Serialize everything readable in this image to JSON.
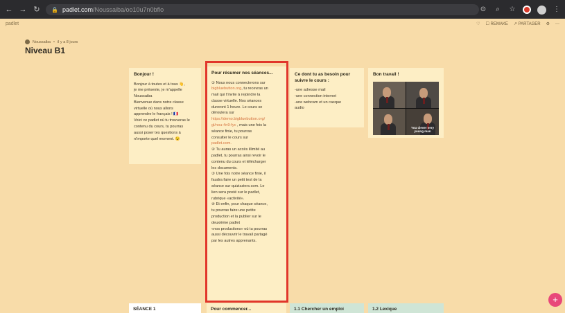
{
  "browser": {
    "url_host": "padlet.com",
    "url_path": "/Noussaiba/oo10u7n0bflo",
    "lock_icon": "lock-icon"
  },
  "padlet": {
    "brand": "padlet",
    "actions": [
      "♡",
      "☐ REMAKE",
      "↗ PARTAGER",
      "⚙",
      "⋯"
    ],
    "breadcrumb_author": "Noussaiba",
    "breadcrumb_sep": "•",
    "breadcrumb_time": "il y a 8 jours",
    "title": "Niveau B1"
  },
  "cards": [
    {
      "title": "Bonjour !",
      "body": "Bonjour à toutes et à tous 👋,\nje me présente, je m'appelle\nNoussaiba\nBienvenue dans notre classe\nvirtuelle où nous allons\napprendre le français ! 🇫🇷\nVoici ce padlet où tu trouveras le\ncontenu du cours, tu pourras\naussi poser tes questions à\nn'importe quel moment. 😉"
    },
    {
      "title": "Pour résumer nos séances...",
      "part1": "① Nous nous connecterons sur\n",
      "link1": "bigbluebutton.org",
      "part2": ", tu recevras un\nmail qui t'invite à rejoindre la\nclasse virtuelle. Nos séances\ndureront 1 heure. Le cours se\ndéroulera sur\n",
      "link2": "https://demo.bigbluebutton.org/\ngl/nou-4n9-fyc",
      "part3": " , mais une fois la\nséance finie, tu pourras\nconsulter le cours sur\n",
      "link3": "padlet.com.",
      "part4": "\n② Tu auras un accès illimité au\npadlet, tu pourras ainsi revoir le\ncontenu du cours et télécharger\nles documents.\n③ Une fois notre séance finie, il\nfaudra faire un petit test de la\nséance sur quizizziers.com. Le\nlien sera posté sur le padlet,\nrubrique «activité».\n④ Et enfin, pour chaque séance,\ntu pourras faire une petite\nproduction et la publier sur le\ndeuxième padlet\n«nos productions» où tu pourras\naussi découvrir le travail partagé\npar les autres apprenants."
    },
    {
      "title": "Ce dont tu as besoin pour suivre le cours :",
      "body": "-une adresse mail\n-une connection internet\n-une webcam et un casque\naudio"
    },
    {
      "title": "Bon travail !",
      "captions": [
        "",
        "",
        "",
        "You clever very\nyoung man"
      ]
    }
  ],
  "bottom_cards": [
    "SÉANCE 1",
    "Pour commencer...",
    "1.1 Chercher un emploi",
    "1.2 Lexique"
  ],
  "fab": {
    "label": "+"
  },
  "colors": {
    "padlet_bg": "#f8dca9",
    "card_bg": "#fdeec5",
    "highlight": "#e1362b",
    "link": "#d4713d",
    "fab": "#e8487a"
  }
}
